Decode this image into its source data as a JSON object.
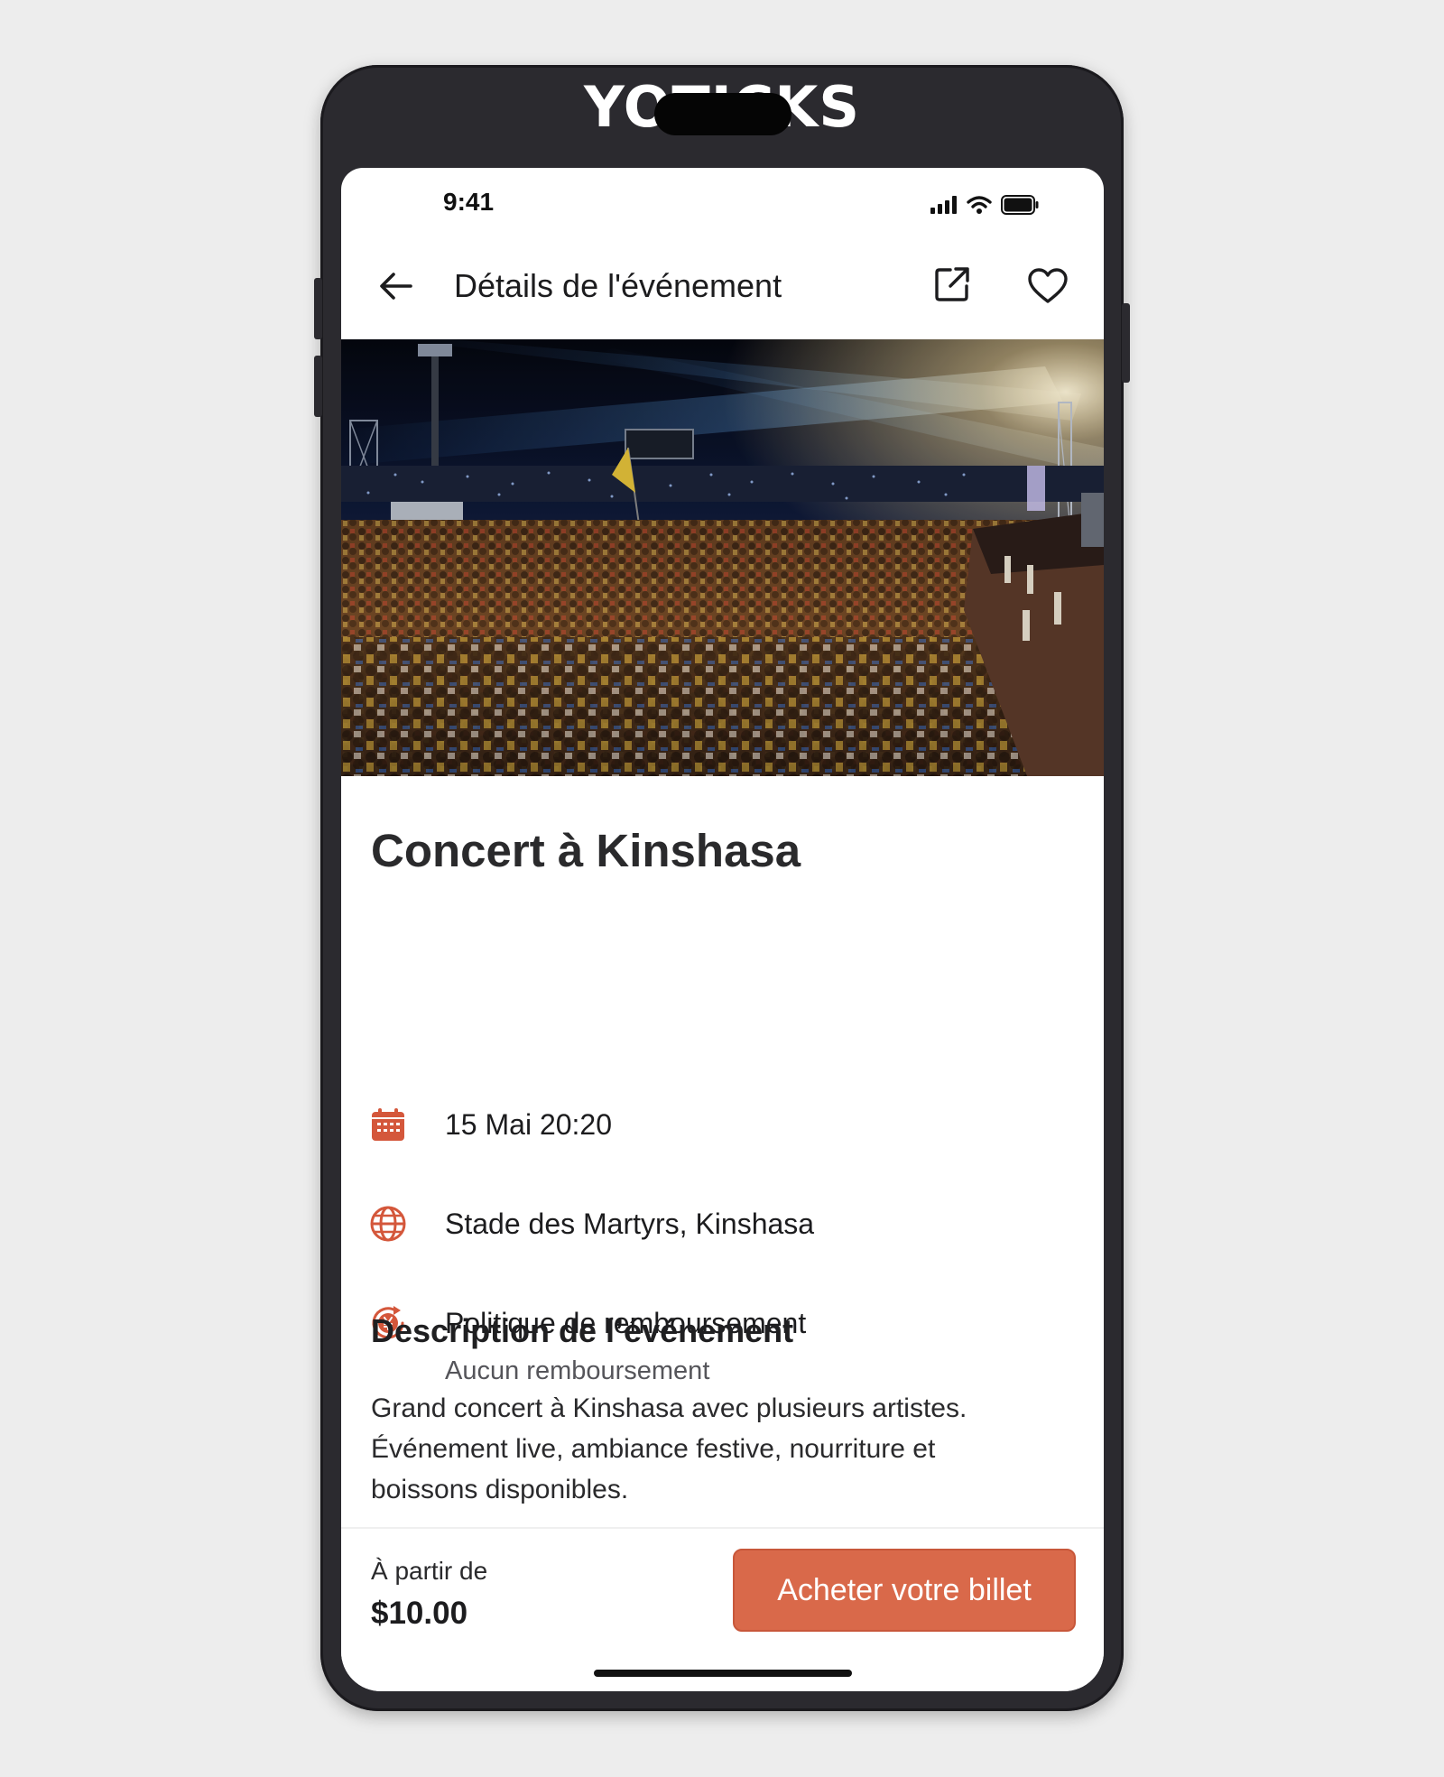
{
  "app": {
    "brand": "YOTICKS"
  },
  "status_bar": {
    "time": "9:41"
  },
  "nav": {
    "title": "Détails de l'événement"
  },
  "event": {
    "title": "Concert à Kinshasa",
    "date": "15 Mai 20:20",
    "location": "Stade des Martyrs, Kinshasa",
    "refund_label": "Politique de remboursement",
    "refund_value": "Aucun remboursement"
  },
  "description": {
    "heading": "Description de l’événement",
    "body_lines": [
      "Grand concert à Kinshasa avec plusieurs artistes.",
      "Événement live, ambiance festive, nourriture et",
      "boissons disponibles."
    ]
  },
  "footer": {
    "price_label": "À partir de",
    "price": "$10.00",
    "buy_label": "Acheter votre billet"
  },
  "icons": {
    "back": "arrow-left-icon",
    "share": "share-external-icon",
    "favorite": "heart-icon",
    "date": "calendar-icon",
    "location": "globe-icon",
    "refund": "refund-coin-icon",
    "signal": "cellular-signal-icon",
    "wifi": "wifi-icon",
    "battery": "battery-icon"
  },
  "colors": {
    "accent": "#d9694a",
    "phone_frame": "#2b2a2f",
    "background": "#ededed",
    "text": "#1c1c1e"
  }
}
